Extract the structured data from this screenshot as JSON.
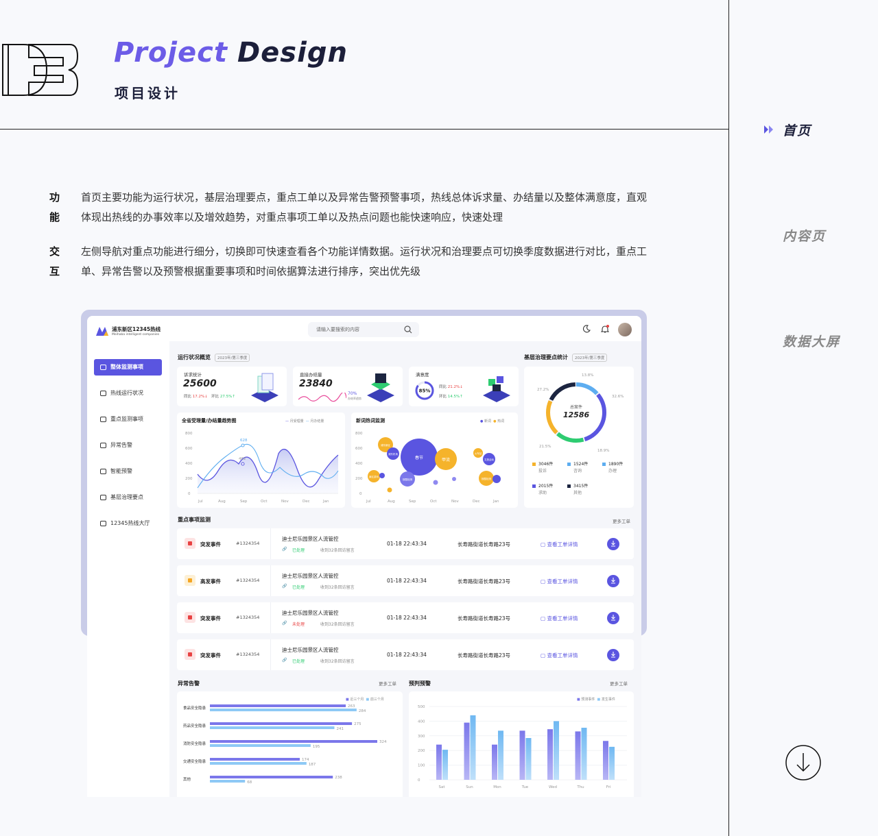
{
  "header": {
    "title_a": "Project",
    "title_b": "Design",
    "subtitle": "项目设计"
  },
  "right_nav": [
    {
      "label": "首页",
      "active": true
    },
    {
      "label": "内容页",
      "active": false
    },
    {
      "label": "数据大屏",
      "active": false
    }
  ],
  "desc": [
    {
      "label": "功能",
      "text": "首页主要功能为运行状况，基层治理要点，重点工单以及异常告警预警事项，热线总体诉求量、办结量以及整体满意度，直观体现出热线的办事效率以及增效趋势，对重点事项工单以及热点问题也能快速响应，快速处理"
    },
    {
      "label": "交互",
      "text": "左侧导航对重点功能进行细分，切换即可快速查看各个功能详情数据。运行状况和治理要点可切换季度数据进行对比，重点工单、异常告警以及预警根据重要事项和时间依据算法进行排序，突出优先级"
    }
  ],
  "app": {
    "logo_title": "浦东新区12345热线",
    "logo_sub": "Meihaba intelligent companies",
    "search_placeholder": "请输入要搜索的内容",
    "nav": [
      "整体监测事项",
      "热线运行状况",
      "重点监测事项",
      "异常告警",
      "智能预警",
      "基层治理要点",
      "12345热线大厅"
    ],
    "overview": {
      "title": "运行状况概览",
      "quarter": "2023年/第三季度"
    },
    "stats": [
      {
        "label": "诉求统计",
        "value": "25600",
        "yoy_label": "同比",
        "yoy": "17.2%",
        "mom_label": "环比",
        "mom": "27.5%"
      },
      {
        "label": "直接办结量",
        "value": "23840",
        "rate": "70%",
        "rate_label": "办结率趋势"
      },
      {
        "label": "满意度",
        "gauge": "85%",
        "yoy_label": "同比",
        "yoy": "21.2%",
        "mom_label": "环比",
        "mom": "14.5%"
      }
    ],
    "governance": {
      "title": "基层治理要点统计",
      "quarter": "2023年/第三季度",
      "center_label": "总案件",
      "center_value": "12586",
      "pcts": [
        "13.8%",
        "32.6%",
        "27.2%",
        "21.5%",
        "18.9%"
      ],
      "legend": [
        {
          "count": "3046件",
          "name": "投诉",
          "color": "#f5b32b"
        },
        {
          "count": "1524件",
          "name": "咨询",
          "color": "#5dadf0"
        },
        {
          "count": "1890件",
          "name": "办理",
          "color": "#5dadf0"
        },
        {
          "count": "2015件",
          "name": "求助",
          "color": "#5a55e0"
        },
        {
          "count": "3415件",
          "name": "其他",
          "color": "#1c2540"
        }
      ]
    },
    "trend": {
      "title": "全省受理量/办结量趋势图",
      "legend_a": "月受理量",
      "legend_b": "月办结量",
      "tip_a": "628",
      "tip_b": "462",
      "y_ticks": [
        "800",
        "600",
        "400",
        "200",
        "0"
      ],
      "x_ticks": [
        "Jul",
        "Aug",
        "Sep",
        "Oct",
        "Nov",
        "Dec",
        "Jan"
      ]
    },
    "hotwords": {
      "title": "新词热词监测",
      "legend_a": "新词",
      "legend_b": "热词",
      "y_ticks": [
        "800",
        "600",
        "400",
        "200",
        "0"
      ],
      "x_ticks": [
        "Jul",
        "Aug",
        "Sep",
        "Oct",
        "Nov",
        "Dec",
        "Jan"
      ],
      "bubbles": [
        "春节",
        "甲流",
        "浦东新区",
        "浦东机场",
        "核酸检测",
        "景区游玩",
        "火车站",
        "文旅活动",
        "核酸检测"
      ]
    },
    "key_monitor": {
      "title": "重点事项监测",
      "more": "更多工单",
      "rows": [
        {
          "type": "突发事件",
          "id": "#1324354",
          "subject": "迪士尼乐园景区人流管控",
          "status": "已处理",
          "msgs": "收到32条回访留言",
          "time": "01-18 22:43:34",
          "addr": "长寿路街道长寿路23号",
          "action": "查看工单详情",
          "color": "red"
        },
        {
          "type": "高发事件",
          "id": "#1324354",
          "subject": "迪士尼乐园景区人流管控",
          "status": "已处理",
          "msgs": "收到32条回访留言",
          "time": "01-18 22:43:34",
          "addr": "长寿路街道长寿路23号",
          "action": "查看工单详情",
          "color": "orange"
        },
        {
          "type": "突发事件",
          "id": "#1324354",
          "subject": "迪士尼乐园景区人流管控",
          "status": "未处理",
          "msgs": "收到32条回访留言",
          "time": "01-18 22:43:34",
          "addr": "长寿路街道长寿路23号",
          "action": "查看工单详情",
          "color": "red"
        },
        {
          "type": "突发事件",
          "id": "#1324354",
          "subject": "迪士尼乐园景区人流管控",
          "status": "已处理",
          "msgs": "收到32条回访留言",
          "time": "01-18 22:43:34",
          "addr": "长寿路街道长寿路23号",
          "action": "查看工单详情",
          "color": "red"
        }
      ]
    },
    "alerts": {
      "title": "异常告警",
      "more": "更多工单",
      "legend_a": "近三个月",
      "legend_b": "前三个月"
    },
    "forecast": {
      "title": "预判预警",
      "more": "更多工单",
      "legend_a": "预测事件",
      "legend_b": "发生事件"
    }
  },
  "chart_data": [
    {
      "type": "bar",
      "title": "异常告警",
      "categories": [
        "食品安全隐患",
        "药品安全隐患",
        "消防安全隐患",
        "交通安全隐患",
        "其他"
      ],
      "series": [
        {
          "name": "近三个月",
          "values": [
            263,
            275,
            324,
            174,
            238
          ]
        },
        {
          "name": "前三个月",
          "values": [
            284,
            241,
            195,
            187,
            68
          ]
        }
      ],
      "orientation": "horizontal"
    },
    {
      "type": "bar",
      "title": "预判预警",
      "categories": [
        "Sat",
        "Sun",
        "Mon",
        "Tue",
        "Wed",
        "Thu",
        "Fri"
      ],
      "series": [
        {
          "name": "预测事件",
          "values": [
            240,
            390,
            240,
            335,
            345,
            330,
            265
          ]
        },
        {
          "name": "发生事件",
          "values": [
            205,
            440,
            335,
            285,
            400,
            355,
            225
          ]
        }
      ],
      "y_ticks": [
        "500",
        "400",
        "300",
        "200",
        "100",
        "0"
      ],
      "ylim": [
        0,
        500
      ]
    }
  ]
}
